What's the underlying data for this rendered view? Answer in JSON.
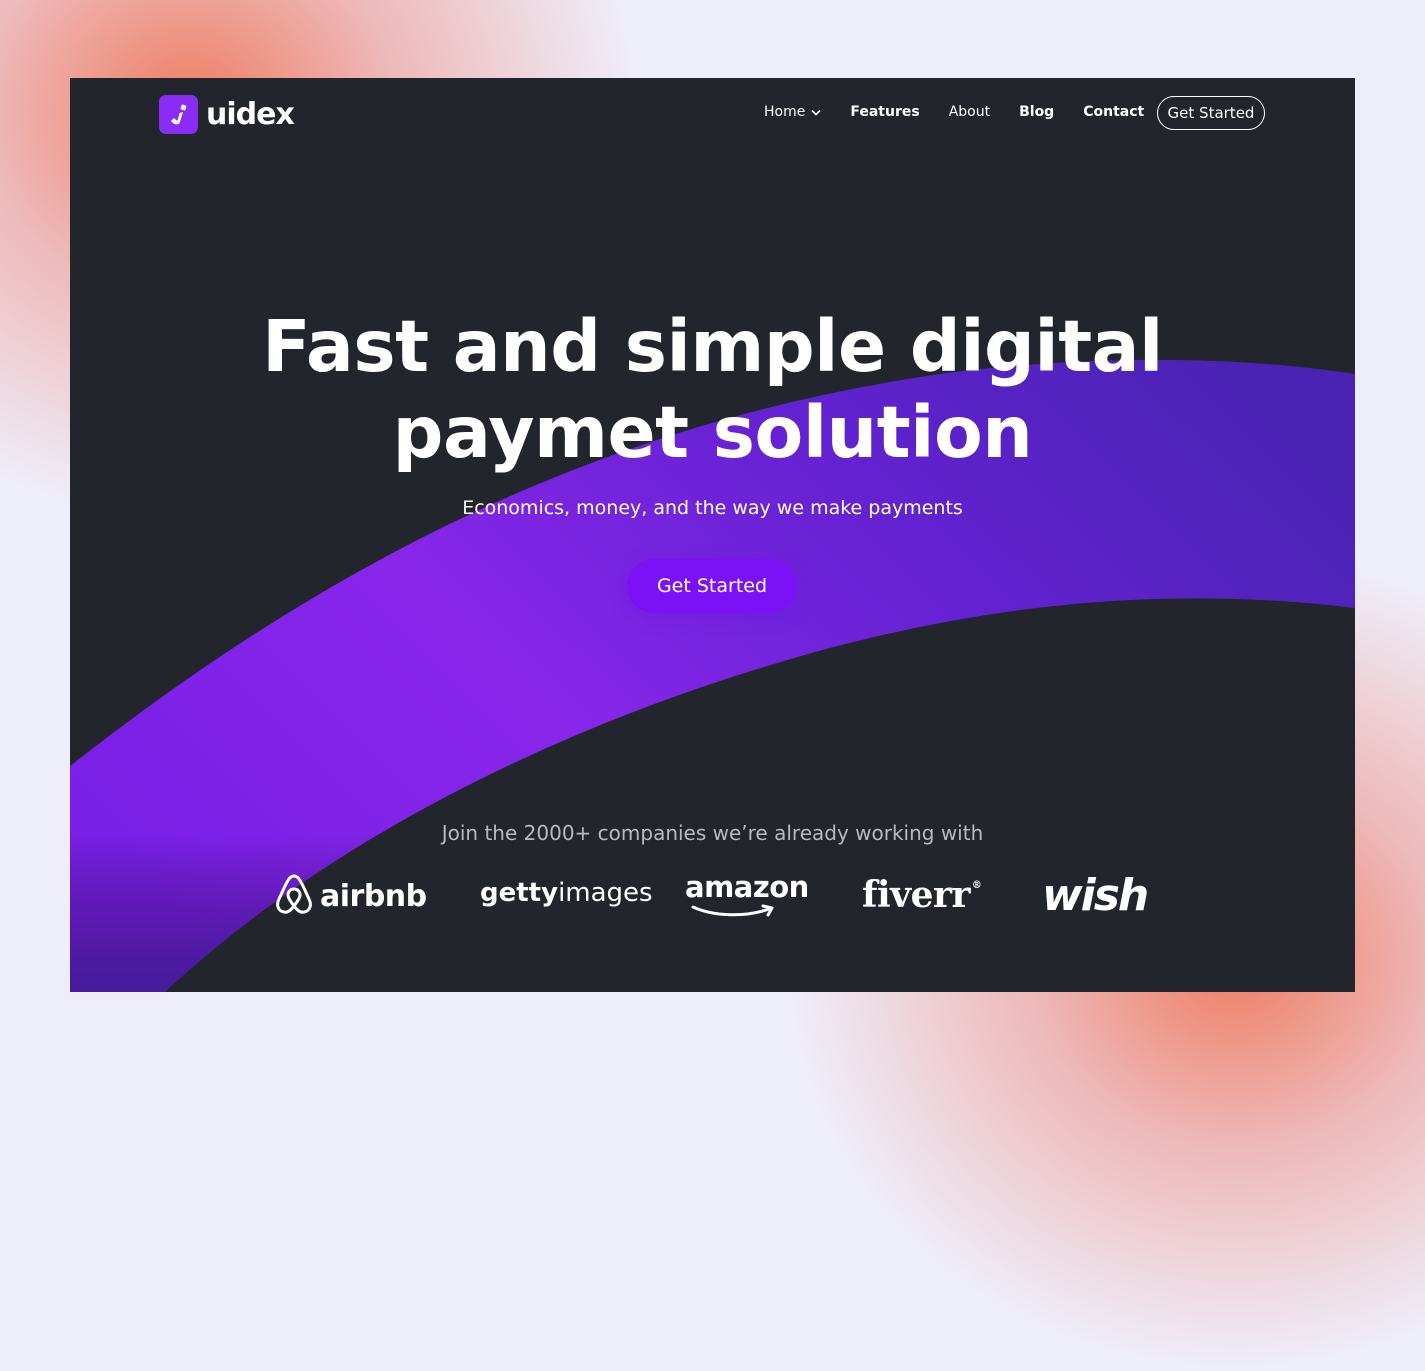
{
  "brand": {
    "name": "uidex"
  },
  "nav": {
    "items": [
      {
        "label": "Home"
      },
      {
        "label": "Features"
      },
      {
        "label": "About"
      },
      {
        "label": "Blog"
      },
      {
        "label": "Contact"
      }
    ],
    "cta_label": "Get Started"
  },
  "hero": {
    "title_line1": "Fast and simple digital",
    "title_line2": "paymet solution",
    "subtitle": "Economics, money, and the way we make payments",
    "cta_label": "Get Started"
  },
  "partners": {
    "title": "Join the 2000+ companies we’re already working with",
    "logos": {
      "airbnb": "airbnb",
      "getty_bold": "getty",
      "getty_light": "images",
      "amazon": "amazon",
      "fiverr": "fiverr",
      "fiverr_mark": "®",
      "wish": "wish"
    }
  },
  "colors": {
    "page_bg": "#eeeefa",
    "frame_bg": "#22252b",
    "accent": "#7b12f5",
    "swoosh_start": "#8a24ee",
    "swoosh_end": "#3a2aa8",
    "muted_text": "#b9b9c2"
  }
}
